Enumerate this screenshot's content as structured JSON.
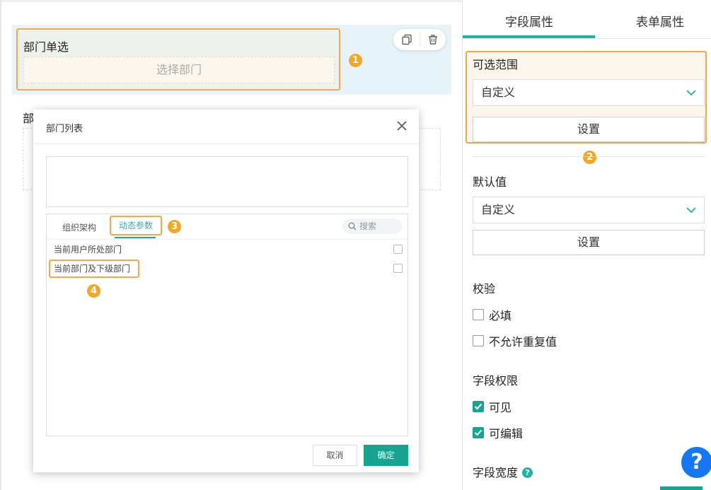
{
  "canvas": {
    "field1": {
      "title": "部门单选",
      "placeholder": "选择部门"
    },
    "field2": {
      "title_partial": "部"
    },
    "badges": {
      "b1": "1",
      "b2": "2",
      "b3": "3",
      "b4": "4"
    },
    "icons": {
      "copy": "copy-icon",
      "delete": "trash-icon"
    }
  },
  "dialog": {
    "title": "部门列表",
    "tabs": [
      {
        "label": "组织架构"
      },
      {
        "label": "动态参数"
      }
    ],
    "active_tab": "动态参数",
    "search_placeholder": "搜索",
    "items": [
      {
        "label": "当前用户所处部门",
        "checked": false
      },
      {
        "label": "当前部门及下级部门",
        "checked": false
      }
    ],
    "cancel_label": "取消",
    "ok_label": "确定"
  },
  "panel": {
    "tabs": [
      {
        "label": "字段属性"
      },
      {
        "label": "表单属性"
      }
    ],
    "active_tab": "字段属性",
    "scope": {
      "title": "可选范围",
      "select_value": "自定义",
      "set_label": "设置"
    },
    "default": {
      "title": "默认值",
      "select_value": "自定义",
      "set_label": "设置"
    },
    "validation": {
      "title": "校验",
      "options": [
        {
          "label": "必填",
          "checked": false
        },
        {
          "label": "不允许重复值",
          "checked": false
        }
      ]
    },
    "permission": {
      "title": "字段权限",
      "options": [
        {
          "label": "可见",
          "checked": true
        },
        {
          "label": "可编辑",
          "checked": true
        }
      ]
    },
    "width": {
      "title": "字段宽度"
    },
    "help_fab": "?"
  },
  "colors": {
    "accent": "#17a592",
    "highlight": "#f3a94a",
    "badge": "#f5a623",
    "help": "#1677f2"
  }
}
